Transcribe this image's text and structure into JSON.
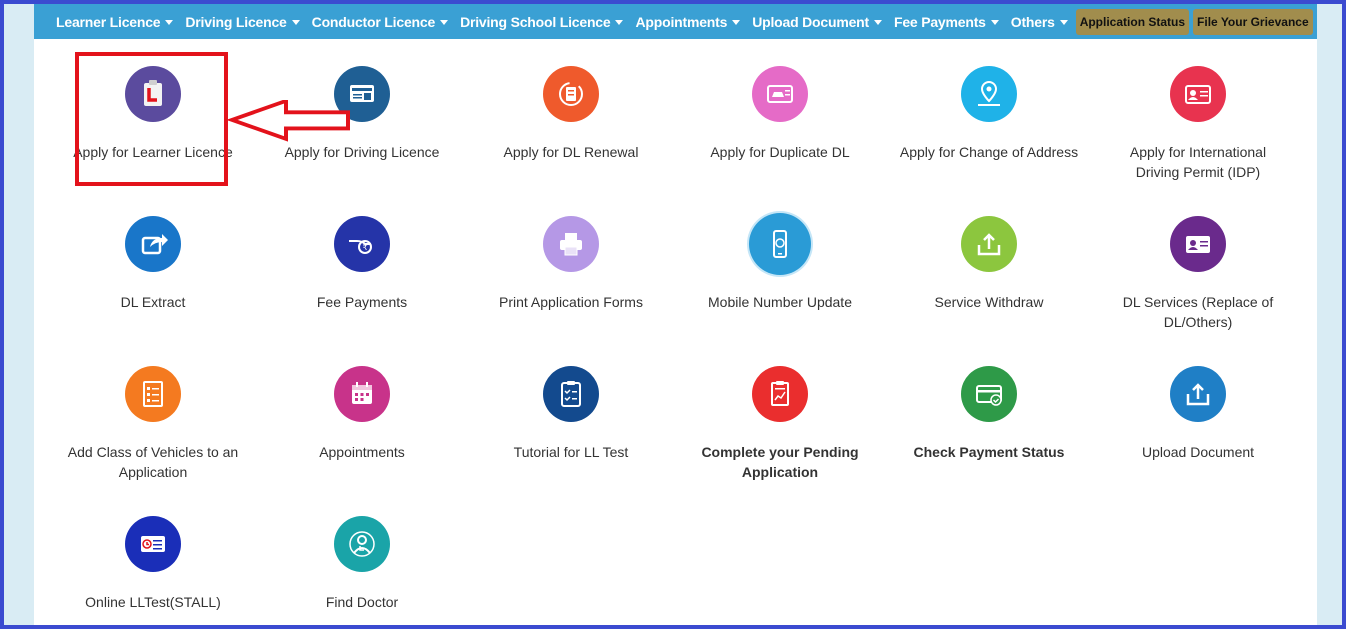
{
  "nav": {
    "items": [
      {
        "label": "Learner Licence"
      },
      {
        "label": "Driving Licence"
      },
      {
        "label": "Conductor Licence"
      },
      {
        "label": "Driving School Licence"
      },
      {
        "label": "Appointments"
      },
      {
        "label": "Upload Document"
      },
      {
        "label": "Fee Payments"
      },
      {
        "label": "Others"
      }
    ],
    "buttons": [
      {
        "label": "Application Status"
      },
      {
        "label": "File Your Grievance"
      }
    ]
  },
  "tiles": [
    {
      "label": "Apply for Learner Licence",
      "icon": "learner-licence-icon",
      "color": "#5b4b9e"
    },
    {
      "label": "Apply for Driving Licence",
      "icon": "driving-licence-icon",
      "color": "#1f5f94"
    },
    {
      "label": "Apply for DL Renewal",
      "icon": "dl-renewal-icon",
      "color": "#ef5a2c"
    },
    {
      "label": "Apply for Duplicate DL",
      "icon": "duplicate-dl-icon",
      "color": "#e56bc7"
    },
    {
      "label": "Apply for Change of Address",
      "icon": "change-address-icon",
      "color": "#1fb2e8"
    },
    {
      "label": "Apply for International Driving Permit (IDP)",
      "icon": "idp-icon",
      "color": "#e8334f"
    },
    {
      "label": "DL Extract",
      "icon": "dl-extract-icon",
      "color": "#1976c9"
    },
    {
      "label": "Fee Payments",
      "icon": "fee-payments-icon",
      "color": "#2534a8"
    },
    {
      "label": "Print Application Forms",
      "icon": "printer-icon",
      "color": "#b598e6"
    },
    {
      "label": "Mobile Number Update",
      "icon": "mobile-icon",
      "color": "#2a9bd6"
    },
    {
      "label": "Service Withdraw",
      "icon": "service-withdraw-icon",
      "color": "#8cc63e"
    },
    {
      "label": "DL Services (Replace of DL/Others)",
      "icon": "dl-services-icon",
      "color": "#6a2a8c"
    },
    {
      "label": "Add Class of Vehicles to an Application",
      "icon": "add-class-icon",
      "color": "#f47a20"
    },
    {
      "label": "Appointments",
      "icon": "calendar-icon",
      "color": "#c8338a"
    },
    {
      "label": "Tutorial for LL Test",
      "icon": "tutorial-icon",
      "color": "#134a8e"
    },
    {
      "label": "Complete your Pending Application",
      "icon": "pending-application-icon",
      "color": "#ea2e2e",
      "bold": true
    },
    {
      "label": "Check Payment Status",
      "icon": "payment-status-icon",
      "color": "#2e9a48",
      "bold": true
    },
    {
      "label": "Upload Document",
      "icon": "upload-icon",
      "color": "#1f7fc6"
    },
    {
      "label": "Online LLTest(STALL)",
      "icon": "online-lltest-icon",
      "color": "#1a2eb8"
    },
    {
      "label": "Find Doctor",
      "icon": "doctor-icon",
      "color": "#1aa4a8"
    }
  ]
}
